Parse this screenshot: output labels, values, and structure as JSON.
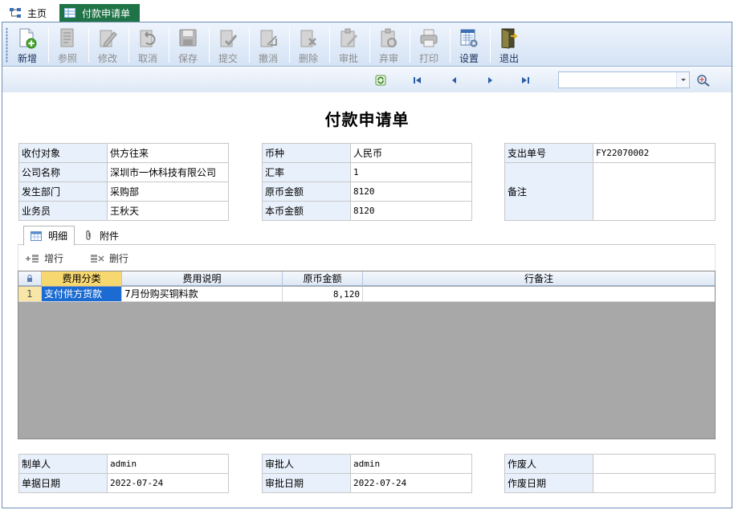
{
  "tabs": [
    {
      "label": "主页"
    },
    {
      "label": "付款申请单"
    }
  ],
  "toolbar": [
    {
      "label": "新增",
      "icon": "new-doc-icon",
      "enabled": true
    },
    {
      "label": "参照",
      "icon": "reference-icon",
      "enabled": false
    },
    {
      "label": "修改",
      "icon": "edit-icon",
      "enabled": false
    },
    {
      "label": "取消",
      "icon": "undo-icon",
      "enabled": false
    },
    {
      "label": "保存",
      "icon": "save-icon",
      "enabled": false
    },
    {
      "label": "提交",
      "icon": "submit-icon",
      "enabled": false
    },
    {
      "label": "撤消",
      "icon": "revoke-icon",
      "enabled": false
    },
    {
      "label": "删除",
      "icon": "delete-icon",
      "enabled": false
    },
    {
      "label": "审批",
      "icon": "approve-icon",
      "enabled": false
    },
    {
      "label": "弃审",
      "icon": "unapprove-icon",
      "enabled": false
    },
    {
      "label": "打印",
      "icon": "print-icon",
      "enabled": false
    },
    {
      "label": "设置",
      "icon": "settings-icon",
      "enabled": true
    },
    {
      "label": "退出",
      "icon": "exit-icon",
      "enabled": true
    }
  ],
  "form_title": "付款申请单",
  "info_left": [
    {
      "label": "收付对象",
      "value": "供方往来"
    },
    {
      "label": "公司名称",
      "value": "深圳市一休科技有限公司"
    },
    {
      "label": "发生部门",
      "value": "采购部"
    },
    {
      "label": "业务员",
      "value": "王秋天"
    }
  ],
  "info_mid": [
    {
      "label": "币种",
      "value": "人民币"
    },
    {
      "label": "汇率",
      "value": "1"
    },
    {
      "label": "原币金额",
      "value": "8120"
    },
    {
      "label": "本币金额",
      "value": "8120"
    }
  ],
  "info_right": {
    "order_no_label": "支出单号",
    "order_no_value": "FY22070002",
    "remark_label": "备注",
    "remark_value": ""
  },
  "detail_tabs": [
    {
      "label": "明细"
    },
    {
      "label": "附件"
    }
  ],
  "row_actions": {
    "add": "增行",
    "delete": "删行"
  },
  "grid": {
    "columns": [
      "费用分类",
      "费用说明",
      "原币金额",
      "行备注"
    ],
    "rows": [
      {
        "index": "1",
        "category": "支付供方货款",
        "description": "7月份购买铜料款",
        "amount": "8,120",
        "remark": ""
      }
    ]
  },
  "footer_left": [
    {
      "label": "制单人",
      "value": "admin"
    },
    {
      "label": "单据日期",
      "value": "2022-07-24"
    }
  ],
  "footer_mid": [
    {
      "label": "审批人",
      "value": "admin"
    },
    {
      "label": "审批日期",
      "value": "2022-07-24"
    }
  ],
  "footer_right": [
    {
      "label": "作废人",
      "value": ""
    },
    {
      "label": "作废日期",
      "value": ""
    }
  ],
  "colors": {
    "active_tab": "#1f7346",
    "selected_cell": "#1c6bd2",
    "header_highlight": "#f7d770",
    "label_bg": "#e8f0fb"
  }
}
